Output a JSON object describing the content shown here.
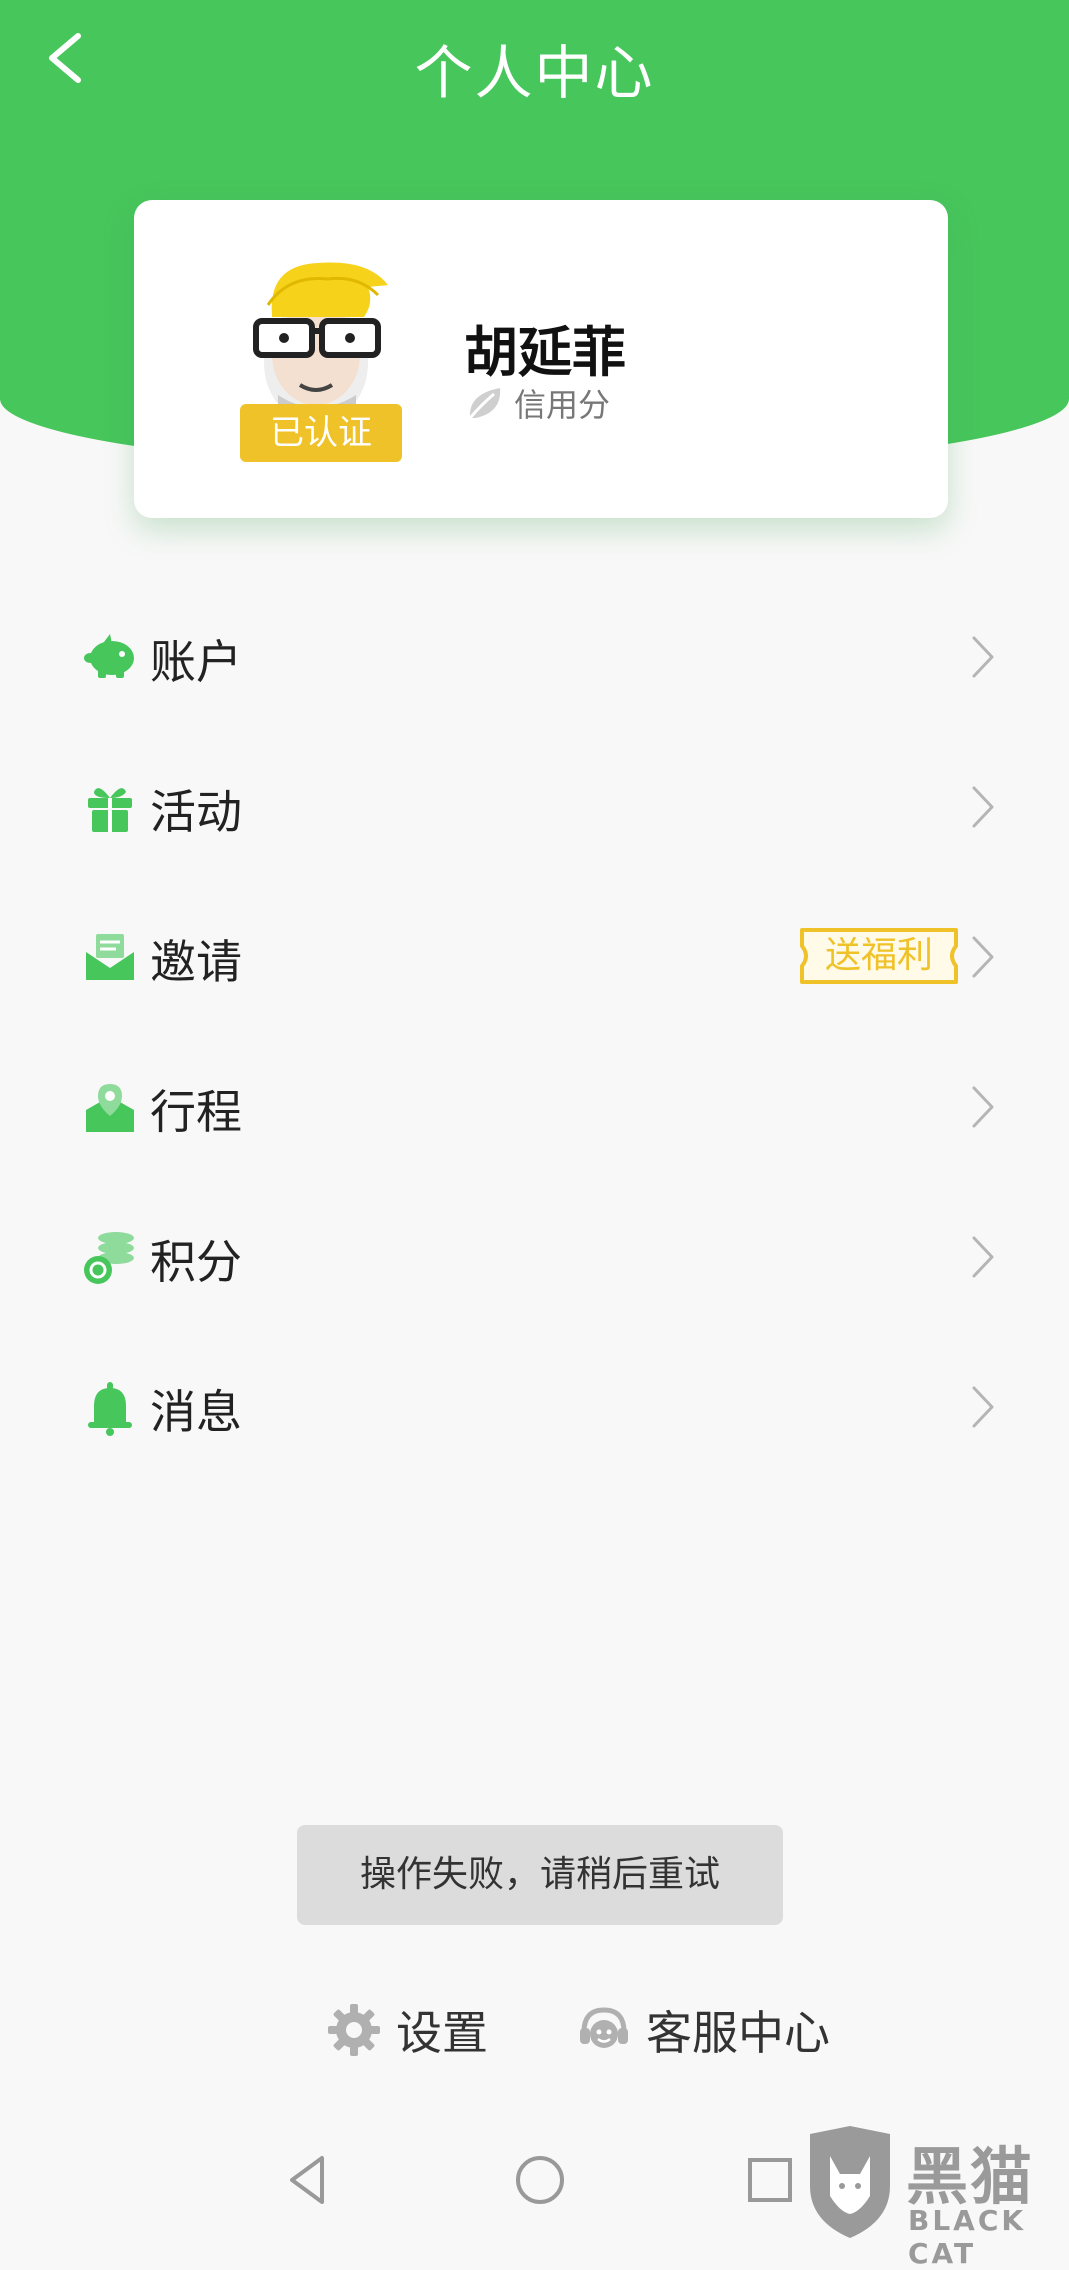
{
  "header": {
    "title": "个人中心",
    "back_icon": "chevron-left-icon"
  },
  "profile": {
    "name": "胡延菲",
    "verified_label": "已认证",
    "credit_label": "信用分",
    "credit_icon": "leaf-icon",
    "avatar_icon": "cartoon-avatar-with-glasses"
  },
  "menu": {
    "items": [
      {
        "label": "账户",
        "icon": "piggy-bank-icon"
      },
      {
        "label": "活动",
        "icon": "gift-icon"
      },
      {
        "label": "邀请",
        "icon": "envelope-icon",
        "badge": "送福利"
      },
      {
        "label": "行程",
        "icon": "map-pin-icon"
      },
      {
        "label": "积分",
        "icon": "coins-icon"
      },
      {
        "label": "消息",
        "icon": "bell-icon"
      }
    ]
  },
  "toast": {
    "message": "操作失败，请稍后重试"
  },
  "footer": {
    "settings_label": "设置",
    "support_label": "客服中心"
  },
  "watermark": {
    "cn": "黑猫",
    "en": "BLACK CAT"
  },
  "colors": {
    "brand_green": "#47c65c",
    "badge_yellow": "#f0c22a",
    "toast_bg": "#dcdcdc",
    "background": "#f8f8f8"
  }
}
